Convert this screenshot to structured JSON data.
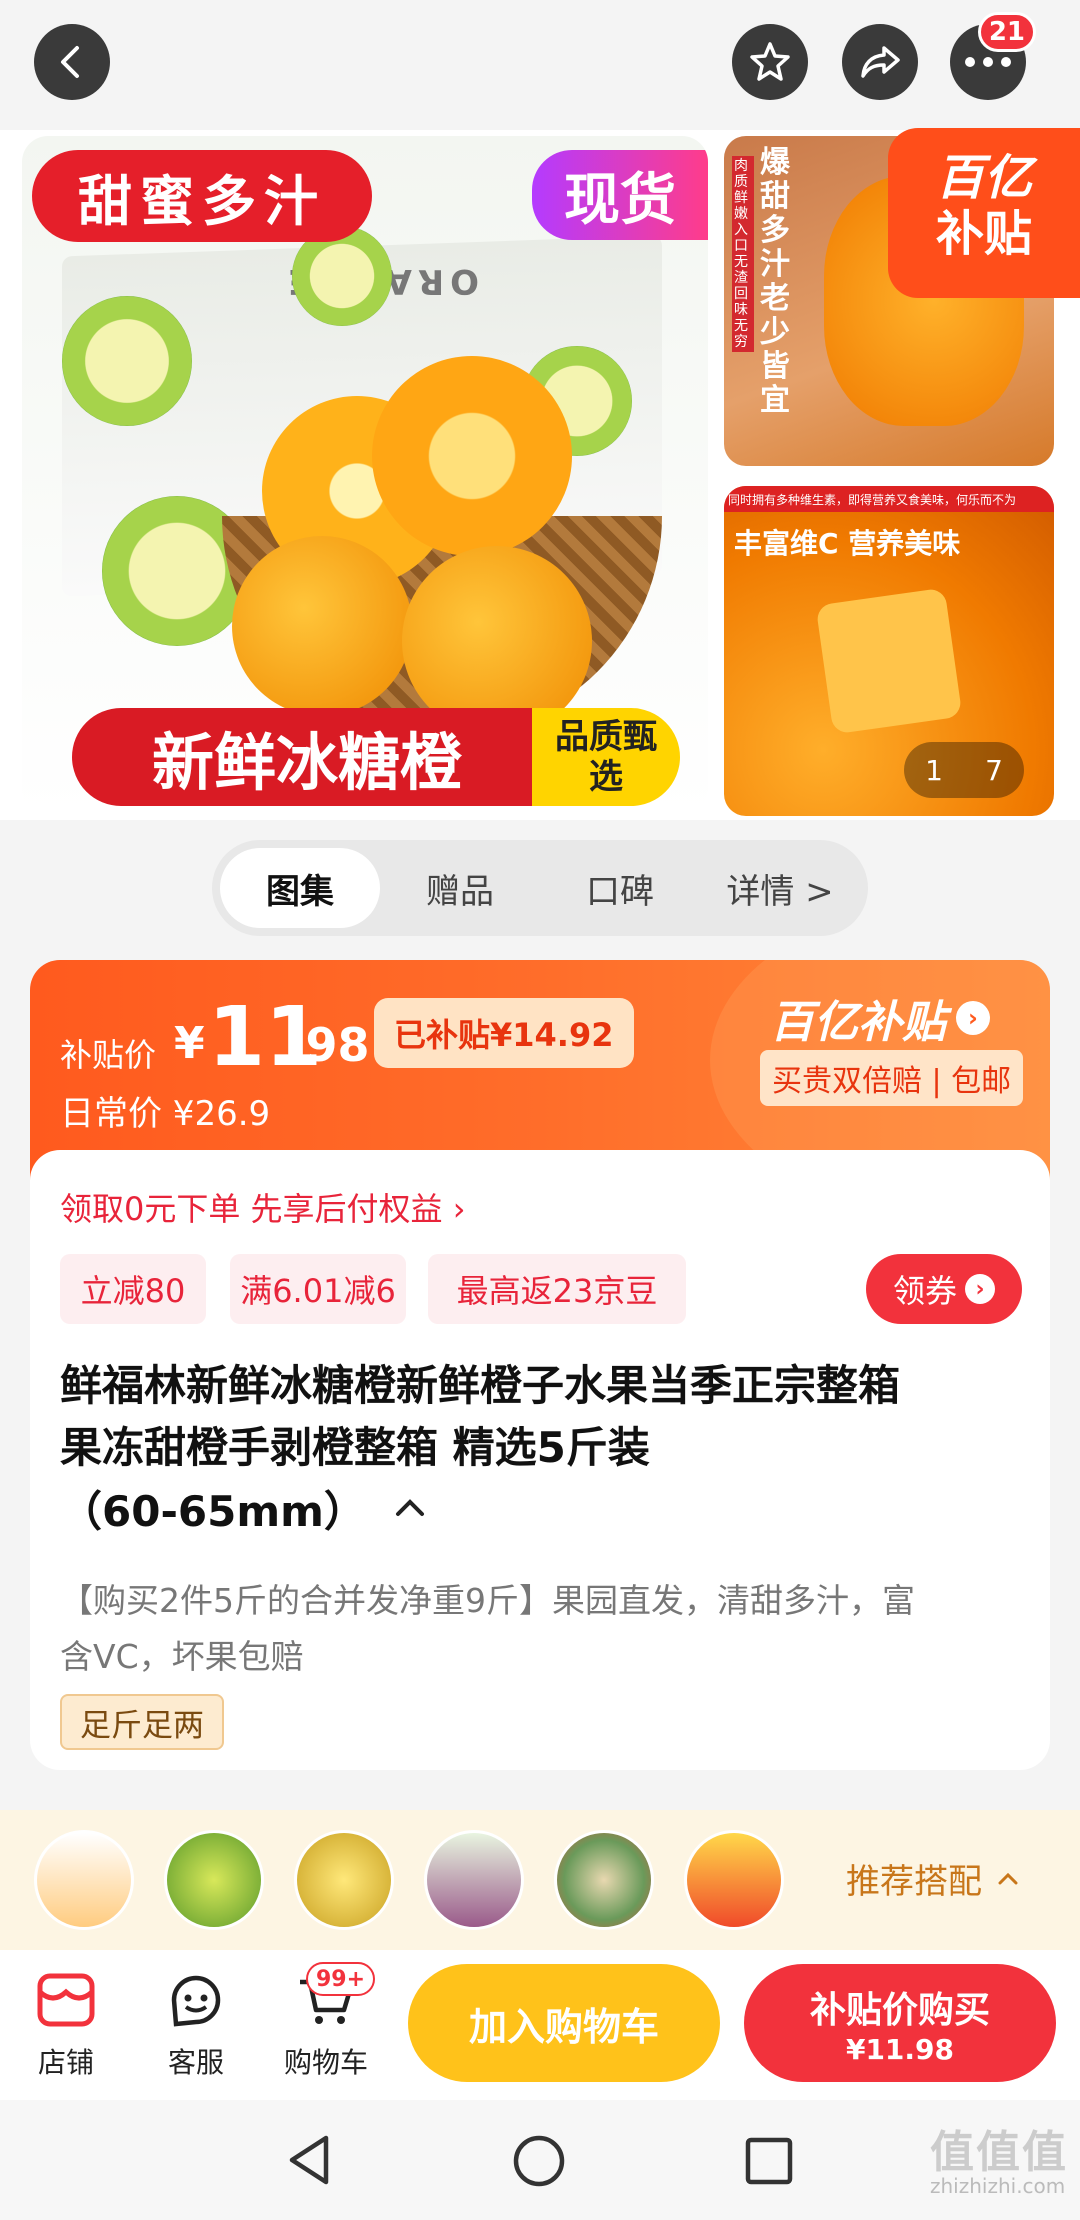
{
  "header": {
    "more_badge": "21"
  },
  "gallery": {
    "main_tag_left": "甜蜜多汁",
    "main_tag_right": "现货",
    "box_label": "ORANGE",
    "main_banner": "新鲜冰糖橙",
    "main_banner_tag": "品质甄选",
    "side1_caption": "爆甜多汁 老少皆宜",
    "side1_small": "肉质鲜嫩入口无渣 回味无穷",
    "subsidy_logo_top": "百亿",
    "subsidy_logo_bottom": "补贴",
    "side2_top_text": "同时拥有多种维生素，即得营养又食美味，何乐而不为",
    "side2_caption": "丰富维C 营养美味",
    "pager_current": "1",
    "pager_total": "7"
  },
  "tabs": [
    "图集",
    "赠品",
    "口碑",
    "详情 >"
  ],
  "price": {
    "label": "补贴价",
    "currency": "¥",
    "integer": "11",
    "decimal": ".98",
    "subsidized_chip": "已补贴¥14.92",
    "daily_label": "日常价 ¥26.9",
    "brand": "百亿补贴",
    "guarantee": "买贵双倍赔 | 包邮"
  },
  "info": {
    "pay_later": "领取0元下单 先享后付权益 ›",
    "tags": [
      "立减80",
      "满6.01减6",
      "最高返23京豆"
    ],
    "coupon_button": "领券",
    "title_line1": "鲜福林新鲜冰糖橙新鲜橙子水果当季正宗整箱",
    "title_line2": "果冻甜橙手剥橙整箱 精选5斤装",
    "title_line3": "（60-65mm）",
    "desc_line1": "【购买2件5斤的合并发净重9斤】果园直发，清甜多汁，富",
    "desc_line2": "含VC，坏果包赔",
    "service_tag": "足斤足两"
  },
  "recommend": {
    "label": "推荐搭配"
  },
  "bottom": {
    "shop": "店铺",
    "service": "客服",
    "cart": "购物车",
    "cart_badge": "99+",
    "add_cart": "加入购物车",
    "buy_label": "补贴价购买",
    "buy_price": "¥11.98"
  },
  "watermark": {
    "brand": "值值值",
    "url": "zhizhizhi.com"
  },
  "colors": {
    "accent": "#ff5a1e",
    "red": "#f2323c",
    "yellow": "#ffc21a"
  }
}
